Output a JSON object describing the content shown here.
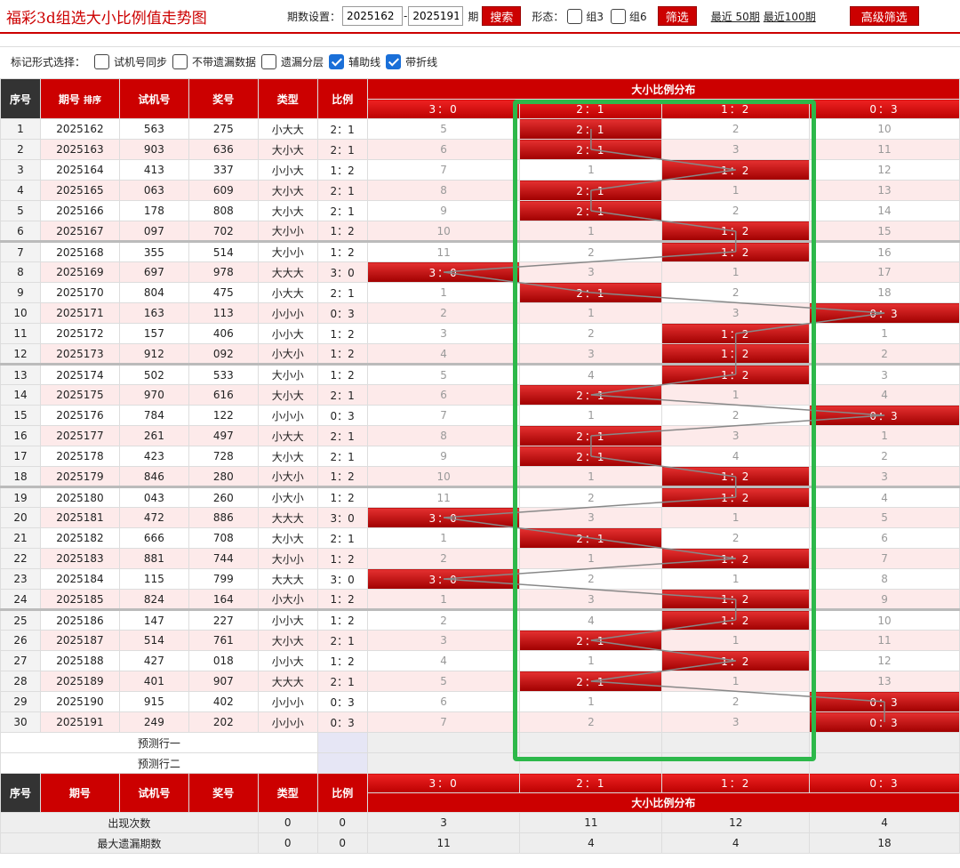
{
  "header": {
    "title": "福彩3d组选大小比例值走势图",
    "period_label": "期数设置：",
    "from": "2025162",
    "dash": "-",
    "to": "2025191",
    "period_unit": "期",
    "search": "搜索",
    "form_label": "形态：",
    "g3": "组3",
    "g6": "组6",
    "filter": "筛选",
    "recent50": "最近 50期",
    "recent100": "最近100期",
    "advanced": "高级筛选"
  },
  "marks": {
    "label": "标记形式选择：",
    "opts": [
      {
        "label": "试机号同步",
        "checked": false
      },
      {
        "label": "不带遗漏数据",
        "checked": false
      },
      {
        "label": "遗漏分层",
        "checked": false
      },
      {
        "label": "辅助线",
        "checked": true
      },
      {
        "label": "带折线",
        "checked": true
      }
    ]
  },
  "columns": {
    "sn": "序号",
    "period": "期号",
    "sort": "排序",
    "test": "试机号",
    "draw": "奖号",
    "type": "类型",
    "ratio": "比例",
    "dist": "大小比例分布",
    "cats": [
      "3：0",
      "2：1",
      "1：2",
      "0：3"
    ]
  },
  "rows": [
    {
      "sn": "1",
      "period": "2025162",
      "test": "563",
      "draw": "275",
      "type": "小大大",
      "ratio": "2：1",
      "d": [
        "5",
        "2：1",
        "2",
        "10"
      ],
      "hit": 1
    },
    {
      "sn": "2",
      "period": "2025163",
      "test": "903",
      "draw": "636",
      "type": "大小大",
      "ratio": "2：1",
      "d": [
        "6",
        "2：1",
        "3",
        "11"
      ],
      "hit": 1
    },
    {
      "sn": "3",
      "period": "2025164",
      "test": "413",
      "draw": "337",
      "type": "小小大",
      "ratio": "1：2",
      "d": [
        "7",
        "1",
        "1：2",
        "12"
      ],
      "hit": 2
    },
    {
      "sn": "4",
      "period": "2025165",
      "test": "063",
      "draw": "609",
      "type": "大小大",
      "ratio": "2：1",
      "d": [
        "8",
        "2：1",
        "1",
        "13"
      ],
      "hit": 1
    },
    {
      "sn": "5",
      "period": "2025166",
      "test": "178",
      "draw": "808",
      "type": "大小大",
      "ratio": "2：1",
      "d": [
        "9",
        "2：1",
        "2",
        "14"
      ],
      "hit": 1
    },
    {
      "sn": "6",
      "period": "2025167",
      "test": "097",
      "draw": "702",
      "type": "大小小",
      "ratio": "1：2",
      "d": [
        "10",
        "1",
        "1：2",
        "15"
      ],
      "hit": 2
    },
    {
      "sn": "7",
      "period": "2025168",
      "test": "355",
      "draw": "514",
      "type": "大小小",
      "ratio": "1：2",
      "d": [
        "11",
        "2",
        "1：2",
        "16"
      ],
      "hit": 2
    },
    {
      "sn": "8",
      "period": "2025169",
      "test": "697",
      "draw": "978",
      "type": "大大大",
      "ratio": "3：0",
      "d": [
        "3：0",
        "3",
        "1",
        "17"
      ],
      "hit": 0
    },
    {
      "sn": "9",
      "period": "2025170",
      "test": "804",
      "draw": "475",
      "type": "小大大",
      "ratio": "2：1",
      "d": [
        "1",
        "2：1",
        "2",
        "18"
      ],
      "hit": 1
    },
    {
      "sn": "10",
      "period": "2025171",
      "test": "163",
      "draw": "113",
      "type": "小小小",
      "ratio": "0：3",
      "d": [
        "2",
        "1",
        "3",
        "0：3"
      ],
      "hit": 3
    },
    {
      "sn": "11",
      "period": "2025172",
      "test": "157",
      "draw": "406",
      "type": "小小大",
      "ratio": "1：2",
      "d": [
        "3",
        "2",
        "1：2",
        "1"
      ],
      "hit": 2
    },
    {
      "sn": "12",
      "period": "2025173",
      "test": "912",
      "draw": "092",
      "type": "小大小",
      "ratio": "1：2",
      "d": [
        "4",
        "3",
        "1：2",
        "2"
      ],
      "hit": 2
    },
    {
      "sn": "13",
      "period": "2025174",
      "test": "502",
      "draw": "533",
      "type": "大小小",
      "ratio": "1：2",
      "d": [
        "5",
        "4",
        "1：2",
        "3"
      ],
      "hit": 2
    },
    {
      "sn": "14",
      "period": "2025175",
      "test": "970",
      "draw": "616",
      "type": "大小大",
      "ratio": "2：1",
      "d": [
        "6",
        "2：1",
        "1",
        "4"
      ],
      "hit": 1
    },
    {
      "sn": "15",
      "period": "2025176",
      "test": "784",
      "draw": "122",
      "type": "小小小",
      "ratio": "0：3",
      "d": [
        "7",
        "1",
        "2",
        "0：3"
      ],
      "hit": 3
    },
    {
      "sn": "16",
      "period": "2025177",
      "test": "261",
      "draw": "497",
      "type": "小大大",
      "ratio": "2：1",
      "d": [
        "8",
        "2：1",
        "3",
        "1"
      ],
      "hit": 1
    },
    {
      "sn": "17",
      "period": "2025178",
      "test": "423",
      "draw": "728",
      "type": "大小大",
      "ratio": "2：1",
      "d": [
        "9",
        "2：1",
        "4",
        "2"
      ],
      "hit": 1
    },
    {
      "sn": "18",
      "period": "2025179",
      "test": "846",
      "draw": "280",
      "type": "小大小",
      "ratio": "1：2",
      "d": [
        "10",
        "1",
        "1：2",
        "3"
      ],
      "hit": 2
    },
    {
      "sn": "19",
      "period": "2025180",
      "test": "043",
      "draw": "260",
      "type": "小大小",
      "ratio": "1：2",
      "d": [
        "11",
        "2",
        "1：2",
        "4"
      ],
      "hit": 2
    },
    {
      "sn": "20",
      "period": "2025181",
      "test": "472",
      "draw": "886",
      "type": "大大大",
      "ratio": "3：0",
      "d": [
        "3：0",
        "3",
        "1",
        "5"
      ],
      "hit": 0
    },
    {
      "sn": "21",
      "period": "2025182",
      "test": "666",
      "draw": "708",
      "type": "大小大",
      "ratio": "2：1",
      "d": [
        "1",
        "2：1",
        "2",
        "6"
      ],
      "hit": 1
    },
    {
      "sn": "22",
      "period": "2025183",
      "test": "881",
      "draw": "744",
      "type": "大小小",
      "ratio": "1：2",
      "d": [
        "2",
        "1",
        "1：2",
        "7"
      ],
      "hit": 2
    },
    {
      "sn": "23",
      "period": "2025184",
      "test": "115",
      "draw": "799",
      "type": "大大大",
      "ratio": "3：0",
      "d": [
        "3：0",
        "2",
        "1",
        "8"
      ],
      "hit": 0
    },
    {
      "sn": "24",
      "period": "2025185",
      "test": "824",
      "draw": "164",
      "type": "小大小",
      "ratio": "1：2",
      "d": [
        "1",
        "3",
        "1：2",
        "9"
      ],
      "hit": 2
    },
    {
      "sn": "25",
      "period": "2025186",
      "test": "147",
      "draw": "227",
      "type": "小小大",
      "ratio": "1：2",
      "d": [
        "2",
        "4",
        "1：2",
        "10"
      ],
      "hit": 2
    },
    {
      "sn": "26",
      "period": "2025187",
      "test": "514",
      "draw": "761",
      "type": "大小大",
      "ratio": "2：1",
      "d": [
        "3",
        "2：1",
        "1",
        "11"
      ],
      "hit": 1
    },
    {
      "sn": "27",
      "period": "2025188",
      "test": "427",
      "draw": "018",
      "type": "小小大",
      "ratio": "1：2",
      "d": [
        "4",
        "1",
        "1：2",
        "12"
      ],
      "hit": 2
    },
    {
      "sn": "28",
      "period": "2025189",
      "test": "401",
      "draw": "907",
      "type": "大大大",
      "ratio": "2：1",
      "d": [
        "5",
        "2：1",
        "1",
        "13"
      ],
      "hit": 1
    },
    {
      "sn": "29",
      "period": "2025190",
      "test": "915",
      "draw": "402",
      "type": "小小小",
      "ratio": "0：3",
      "d": [
        "6",
        "1",
        "2",
        "0：3"
      ],
      "hit": 3
    },
    {
      "sn": "30",
      "period": "2025191",
      "test": "249",
      "draw": "202",
      "type": "小小小",
      "ratio": "0：3",
      "d": [
        "7",
        "2",
        "3",
        "0：3"
      ],
      "hit": 3
    }
  ],
  "pred1": "预测行一",
  "pred2": "预测行二",
  "stats": [
    {
      "label": "出现次数",
      "type": "0",
      "ratio": "0",
      "d": [
        "3",
        "11",
        "12",
        "4"
      ]
    },
    {
      "label": "最大遗漏期数",
      "type": "0",
      "ratio": "0",
      "d": [
        "11",
        "4",
        "4",
        "18"
      ]
    }
  ],
  "colors": {
    "accent": "#cc0000",
    "highlight": "#2db84a"
  }
}
